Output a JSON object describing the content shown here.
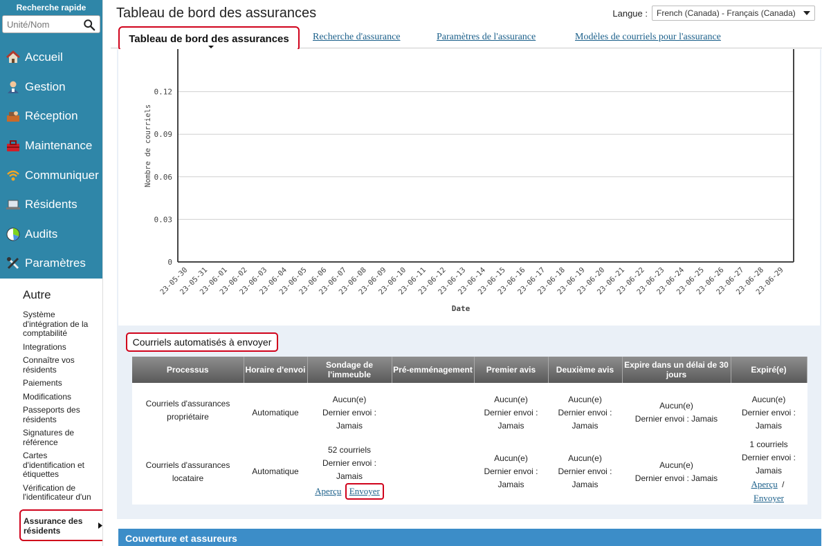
{
  "sidebar": {
    "quick_search_title": "Recherche rapide",
    "quick_search_placeholder": "Unité/Nom",
    "nav": [
      {
        "label": "Accueil",
        "icon": "home-icon"
      },
      {
        "label": "Gestion",
        "icon": "user-icon"
      },
      {
        "label": "Réception",
        "icon": "reception-icon"
      },
      {
        "label": "Maintenance",
        "icon": "toolbox-icon"
      },
      {
        "label": "Communiquer",
        "icon": "wifi-icon"
      },
      {
        "label": "Résidents",
        "icon": "laptop-icon"
      },
      {
        "label": "Audits",
        "icon": "pie-chart-icon"
      },
      {
        "label": "Paramètres",
        "icon": "tools-icon"
      }
    ],
    "other_title": "Autre",
    "other_items": [
      "Système d'intégration de la comptabilité",
      "Integrations",
      "Connaître vos résidents",
      "Paiements",
      "Modifications",
      "Passeports des résidents",
      "Signatures de référence",
      "Cartes d'identification et étiquettes",
      "Vérification de l'identificateur d'un résident",
      "Assurance des résidents"
    ]
  },
  "header": {
    "title": "Tableau de bord des assurances",
    "lang_label": "Langue :",
    "lang_value": "French (Canada) - Français (Canada)"
  },
  "tabs": [
    "Tableau de bord des assurances",
    "Recherche d'assurance",
    "Paramètres de l'assurance",
    "Modèles de courriels pour l'assurance"
  ],
  "chart_data": {
    "type": "line",
    "title": "",
    "xlabel": "Date",
    "ylabel": "Nombre de courriels",
    "ylim": [
      0,
      0.15
    ],
    "yticks": [
      0,
      0.03,
      0.06,
      0.09,
      0.12
    ],
    "grid": true,
    "x": [
      "23-05-30",
      "23-05-31",
      "23-06-01",
      "23-06-02",
      "23-06-03",
      "23-06-04",
      "23-06-05",
      "23-06-06",
      "23-06-07",
      "23-06-08",
      "23-06-09",
      "23-06-10",
      "23-06-11",
      "23-06-12",
      "23-06-13",
      "23-06-14",
      "23-06-15",
      "23-06-16",
      "23-06-17",
      "23-06-18",
      "23-06-19",
      "23-06-20",
      "23-06-21",
      "23-06-22",
      "23-06-23",
      "23-06-24",
      "23-06-25",
      "23-06-26",
      "23-06-27",
      "23-06-28",
      "23-06-29"
    ],
    "series": []
  },
  "emails_section": {
    "title": "Courriels automatisés à envoyer",
    "headers": [
      "Processus",
      "Horaire d'envoi",
      "Sondage de l'immeuble",
      "Pré-emménagement",
      "Premier avis",
      "Deuxième avis",
      "Expire dans un délai de 30 jours",
      "Expiré(e)"
    ],
    "rows": [
      {
        "process": "Courriels d'assurances propriétaire",
        "schedule": "Automatique",
        "survey": "Aucun(e)\nDernier envoi :\nJamais",
        "pre_move": "",
        "first": "Aucun(e)\nDernier envoi :\nJamais",
        "second": "Aucun(e)\nDernier envoi :\nJamais",
        "expire30": "Aucun(e)\nDernier envoi : Jamais",
        "expired": "Aucun(e)\nDernier envoi :\nJamais"
      },
      {
        "process": "Courriels d'assurances locataire",
        "schedule": "Automatique",
        "survey": "52 courriels\nDernier envoi :\nJamais",
        "survey_preview": "Aperçu",
        "survey_send": "Envoyer",
        "pre_move": "",
        "first": "Aucun(e)\nDernier envoi :\nJamais",
        "second": "Aucun(e)\nDernier envoi :\nJamais",
        "expire30": "Aucun(e)\nDernier envoi : Jamais",
        "expired": "1 courriels\nDernier envoi :\nJamais",
        "expired_preview": "Aperçu",
        "expired_sep": "/",
        "expired_send": "Envoyer"
      }
    ]
  },
  "coverage": {
    "title": "Couverture et assureurs"
  },
  "colors": {
    "sidebar": "#2f86a8",
    "highlight": "#d0021b",
    "link": "#1a5f8a",
    "content_bg": "#eaf0f7",
    "bar": "#3c8dc8"
  }
}
